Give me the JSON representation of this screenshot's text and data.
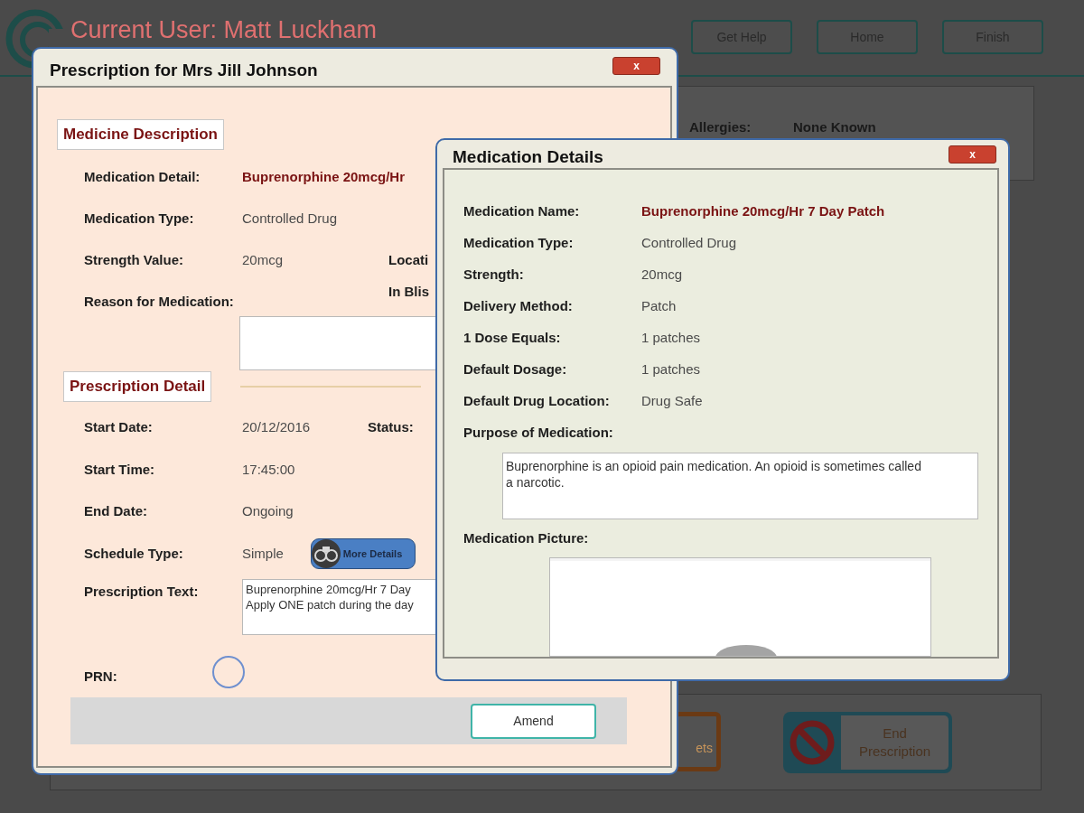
{
  "app": {
    "current_user": "Current User: Matt Luckham",
    "nav_buttons": [
      "Get Help",
      "Home",
      "Finish"
    ],
    "allergies_label": "Allergies:",
    "allergies_value": "None Known",
    "footer_buttons": [
      {
        "kind": "partial",
        "label": "ets"
      },
      {
        "kind": "end",
        "label": "End Prescription"
      }
    ]
  },
  "prescription_dialog": {
    "title": "Prescription for Mrs Jill Johnson",
    "close": "x",
    "medicine_heading": "Medicine Description",
    "medicine_rows": [
      {
        "label": "Medication Detail:",
        "value": "Buprenorphine 20mcg/Hr",
        "emphasis": true
      },
      {
        "label": "Medication Type:",
        "value": "Controlled Drug",
        "emphasis": false
      },
      {
        "label": "Strength Value:",
        "value": "20mcg",
        "emphasis": false,
        "side": [
          "Locati",
          "In Blis"
        ]
      },
      {
        "label": "Reason for Medication:"
      }
    ],
    "prescription_heading": "Prescription Detail",
    "prescription_rows": [
      {
        "kind": "text",
        "label": "Start Date:",
        "value": "20/12/2016",
        "side": [
          "Status:"
        ]
      },
      {
        "kind": "text",
        "label": "Start Time:",
        "value": "17:45:00"
      },
      {
        "kind": "text",
        "label": "End Date:",
        "value": "Ongoing"
      },
      {
        "kind": "button",
        "label": "Schedule Type:",
        "value": "Simple",
        "button": "More Details"
      },
      {
        "kind": "textarea",
        "label": "Prescription Text:",
        "lines": [
          "Buprenorphine 20mcg/Hr 7 Day",
          "Apply ONE patch during the day"
        ]
      }
    ],
    "prn_label": "PRN:",
    "prn_checked": false,
    "amend_button": "Amend"
  },
  "details_dialog": {
    "title": "Medication Details",
    "close": "x",
    "rows": [
      {
        "label": "Medication Name:",
        "value": "Buprenorphine 20mcg/Hr 7 Day Patch",
        "emphasis": true
      },
      {
        "label": "Medication Type:",
        "value": "Controlled Drug",
        "emphasis": false
      },
      {
        "label": "Strength:",
        "value": "20mcg",
        "emphasis": false
      },
      {
        "label": "Delivery Method:",
        "value": "Patch",
        "emphasis": false
      },
      {
        "label": "1 Dose Equals:",
        "value": "1 patches",
        "emphasis": false
      },
      {
        "label": "Default Dosage:",
        "value": "1 patches",
        "emphasis": false
      },
      {
        "label": "Default Drug Location:",
        "value": "Drug Safe",
        "emphasis": false
      }
    ],
    "purpose_label": "Purpose of Medication:",
    "purpose_text": [
      "Buprenorphine is an opioid pain medication. An opioid is sometimes called a narcotic."
    ],
    "picture_label": "Medication Picture:",
    "picture": {
      "kind": "picture"
    }
  }
}
